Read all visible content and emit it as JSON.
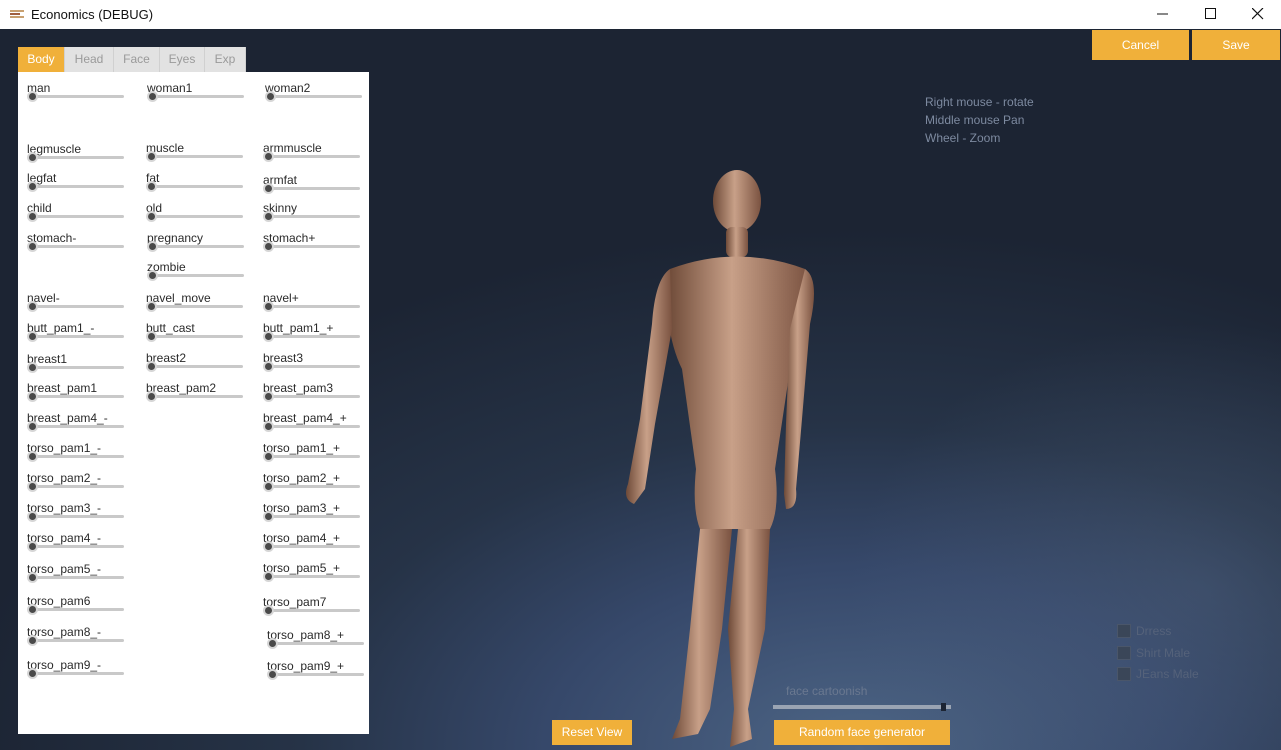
{
  "window": {
    "title": "Economics (DEBUG)"
  },
  "tabs": [
    {
      "label": "Body",
      "active": true
    },
    {
      "label": "Head",
      "active": false
    },
    {
      "label": "Face",
      "active": false
    },
    {
      "label": "Eyes",
      "active": false
    },
    {
      "label": "Exp",
      "active": false
    }
  ],
  "sliders": [
    "man",
    "woman1",
    "woman2",
    "legmuscle",
    "muscle",
    "armmuscle",
    "legfat",
    "fat",
    "armfat",
    "child",
    "old",
    "skinny",
    "stomach-",
    "pregnancy",
    "stomach+",
    "zombie",
    "navel-",
    "navel_move",
    "navel+",
    "butt_pam1_-",
    "butt_cast",
    "butt_pam1_+",
    "breast1",
    "breast2",
    "breast3",
    "breast_pam1",
    "breast_pam2",
    "breast_pam3",
    "breast_pam4_-",
    "breast_pam4_+",
    "torso_pam1_-",
    "torso_pam1_+",
    "torso_pam2_-",
    "torso_pam2_+",
    "torso_pam3_-",
    "torso_pam3_+",
    "torso_pam4_-",
    "torso_pam4_+",
    "torso_pam5_-",
    "torso_pam5_+",
    "torso_pam6",
    "torso_pam7",
    "torso_pam8_-",
    "torso_pam8_+",
    "torso_pam9_-",
    "torso_pam9_+"
  ],
  "buttons": {
    "cancel": "Cancel",
    "save": "Save",
    "reset_view": "Reset View",
    "random_face": "Random face generator"
  },
  "help": {
    "line1": "Right mouse - rotate",
    "line2": "Middle mouse Pan",
    "line3": "Wheel - Zoom"
  },
  "clothing": [
    {
      "label": "Drress",
      "checked": false
    },
    {
      "label": "Shirt Male",
      "checked": false
    },
    {
      "label": "JEans Male",
      "checked": false
    }
  ],
  "face_cartoonish": {
    "label": "face cartoonish",
    "value": 0.95
  },
  "colors": {
    "accent": "#f0b03a",
    "panel": "#ffffff",
    "background": "#1c2431"
  }
}
